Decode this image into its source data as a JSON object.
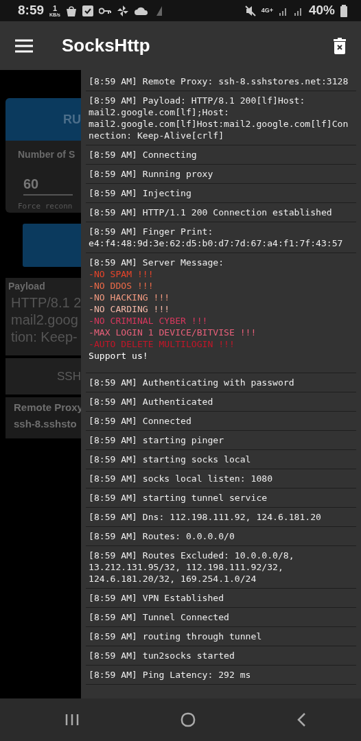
{
  "status_bar": {
    "time": "8:59",
    "speed_value": "1",
    "speed_unit": "KB/s",
    "network": "4G+",
    "battery": "40%"
  },
  "app_bar": {
    "title": "SocksHttp"
  },
  "background": {
    "run_button": "RU",
    "sessions_label": "Number of S",
    "sessions_value": "60",
    "force_note": "Force reconn",
    "payload_label": "Payload",
    "payload_lines": [
      "HTTP/8.1 2",
      "mail2.goog",
      "tion: Keep-"
    ],
    "ssh_button": "SSH",
    "remote_proxy_label": "Remote Proxy",
    "remote_proxy_value": "ssh-8.sshsto"
  },
  "log": [
    {
      "kind": "text",
      "text": "[8:59 AM] Remote Proxy: ssh-8.sshstores.net:3128"
    },
    {
      "kind": "text",
      "text": "[8:59 AM] Payload: HTTP/8.1 200[lf]Host: mail2.google.com[lf];Host: mail2.google.com[lf]Host:mail2.google.com[lf]Connection: Keep-Alive[crlf]"
    },
    {
      "kind": "text",
      "text": "[8:59 AM] Connecting"
    },
    {
      "kind": "text",
      "text": "[8:59 AM] Running proxy"
    },
    {
      "kind": "text",
      "text": "[8:59 AM] Injecting"
    },
    {
      "kind": "text",
      "text": "[8:59 AM] HTTP/1.1 200 Connection established"
    },
    {
      "kind": "text",
      "text": "[8:59 AM] Finger Print: e4:f4:48:9d:3e:62:d5:b0:d7:7d:67:a4:f1:7f:43:57"
    },
    {
      "kind": "server",
      "text": "[8:59 AM] Server Message:",
      "lines": [
        {
          "text": "-NO SPAM !!!",
          "color": "#e8442a"
        },
        {
          "text": "-NO DDOS !!!",
          "color": "#ec6a48"
        },
        {
          "text": "-NO HACKING !!!",
          "color": "#f29a80"
        },
        {
          "text": "-NO CARDING !!!",
          "color": "#f4b8a8"
        },
        {
          "text": "-NO CRIMINAL CYBER !!!",
          "color": "#d8385e"
        },
        {
          "text": "-MAX LOGIN 1 DEVICE/BITVISE !!!",
          "color": "#e8607a"
        },
        {
          "text": "-AUTO DELETE MULTILOGIN !!!",
          "color": "#c41628"
        },
        {
          "text": "Support us!",
          "color": "#ffffff"
        }
      ]
    },
    {
      "kind": "text",
      "text": "[8:59 AM] Authenticating with password"
    },
    {
      "kind": "text",
      "text": "[8:59 AM] Authenticated"
    },
    {
      "kind": "text",
      "text": "[8:59 AM] Connected"
    },
    {
      "kind": "text",
      "text": "[8:59 AM] starting pinger"
    },
    {
      "kind": "text",
      "text": "[8:59 AM] starting socks local"
    },
    {
      "kind": "text",
      "text": "[8:59 AM] socks local listen: 1080"
    },
    {
      "kind": "text",
      "text": "[8:59 AM] starting tunnel service"
    },
    {
      "kind": "text",
      "text": "[8:59 AM] Dns: 112.198.111.92, 124.6.181.20"
    },
    {
      "kind": "text",
      "text": "[8:59 AM] Routes: 0.0.0.0/0"
    },
    {
      "kind": "text",
      "text": "[8:59 AM] Routes Excluded: 10.0.0.0/8, 13.212.131.95/32, 112.198.111.92/32, 124.6.181.20/32, 169.254.1.0/24"
    },
    {
      "kind": "text",
      "text": "[8:59 AM] VPN Established"
    },
    {
      "kind": "text",
      "text": "[8:59 AM] Tunnel Connected"
    },
    {
      "kind": "text",
      "text": "[8:59 AM] routing through tunnel"
    },
    {
      "kind": "text",
      "text": "[8:59 AM] tun2socks started"
    },
    {
      "kind": "text",
      "text": "[8:59 AM] Ping Latency: 292 ms"
    }
  ]
}
